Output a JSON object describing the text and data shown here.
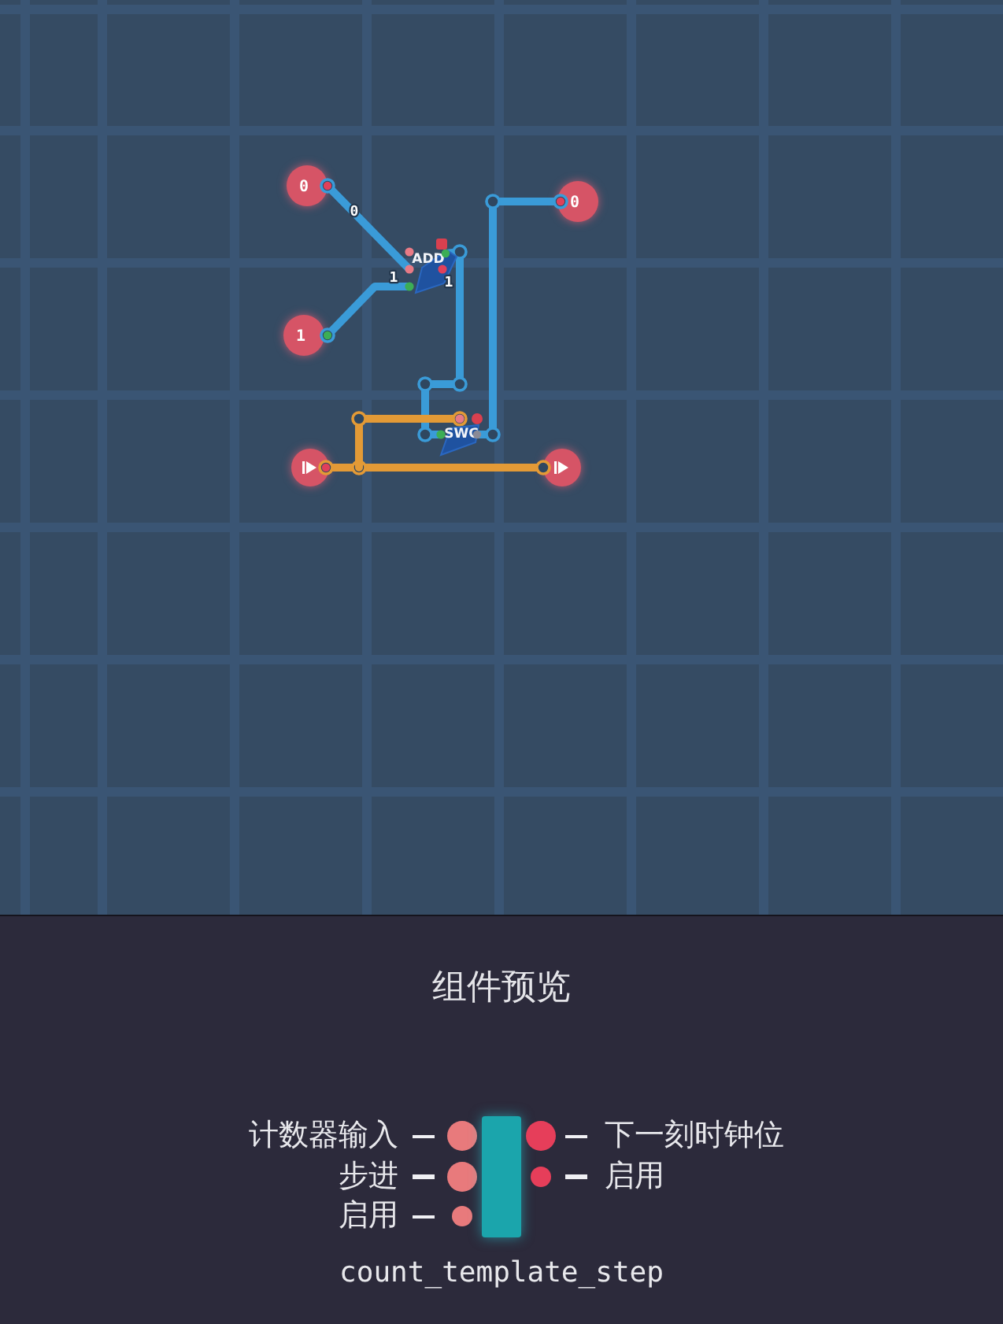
{
  "canvas": {
    "pins": [
      {
        "kind": "value",
        "text": "0"
      },
      {
        "kind": "value",
        "text": "1"
      },
      {
        "kind": "value",
        "text": "0"
      },
      {
        "kind": "clock"
      },
      {
        "kind": "clock"
      }
    ],
    "wires": [
      {
        "kind": "data",
        "label": "0"
      },
      {
        "kind": "data",
        "label": "1"
      },
      {
        "kind": "data",
        "label": "1"
      },
      {
        "kind": "data"
      },
      {
        "kind": "clock"
      },
      {
        "kind": "clock"
      }
    ],
    "gates": [
      {
        "label": "ADD"
      },
      {
        "label": "SWC"
      }
    ],
    "ports": [
      {
        "color": "#e0405a"
      },
      {
        "color": "#3cae55"
      },
      {
        "color": "#e0405a"
      },
      {
        "color": "#e0405a"
      },
      {
        "color": "#e87a85"
      },
      {
        "color": "#e87a85"
      },
      {
        "color": "#3cae55"
      },
      {
        "color": "#3cae55"
      },
      {
        "color": "#e0405a"
      },
      {
        "color": "#e87a85"
      },
      {
        "color": "#3cae55"
      },
      {
        "color": "#8a8a96"
      }
    ]
  },
  "preview": {
    "title": "组件预览",
    "name": "count_template_step",
    "inputs": [
      {
        "label": "计数器输入",
        "kind": "bus"
      },
      {
        "label": "步进",
        "kind": "bus"
      },
      {
        "label": "启用",
        "kind": "bit"
      }
    ],
    "outputs": [
      {
        "label": "下一刻时钟位",
        "kind": "bus"
      },
      {
        "label": "启用",
        "kind": "bit"
      }
    ]
  }
}
